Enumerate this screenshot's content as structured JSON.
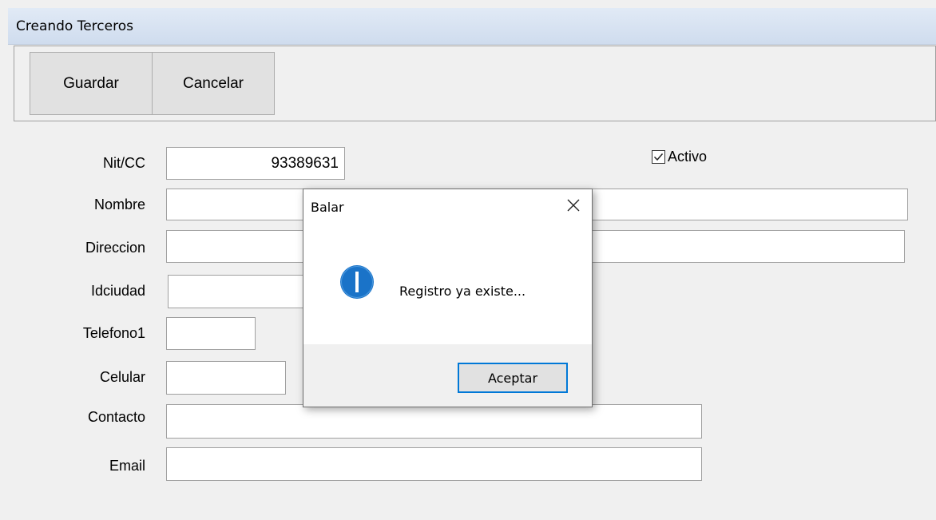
{
  "window": {
    "title": "Creando Terceros"
  },
  "toolbar": {
    "save_label": "Guardar",
    "cancel_label": "Cancelar"
  },
  "form": {
    "nit_label": "Nit/CC",
    "nit_value": "93389631",
    "nombre_label": "Nombre",
    "nombre_value": "",
    "direccion_label": "Direccion",
    "direccion_value": "",
    "idciudad_label": "Idciudad",
    "idciudad_value": "",
    "telefono1_label": "Telefono1",
    "telefono1_value": "",
    "celular_label": "Celular",
    "celular_value": "",
    "contacto_label": "Contacto",
    "contacto_value": "",
    "email_label": "Email",
    "email_value": "",
    "activo_label": "Activo",
    "activo_checked": true
  },
  "dialog": {
    "title": "Balar",
    "message": "Registro ya existe...",
    "ok_label": "Aceptar",
    "icon": "info-icon",
    "accent": "#0078d7"
  }
}
